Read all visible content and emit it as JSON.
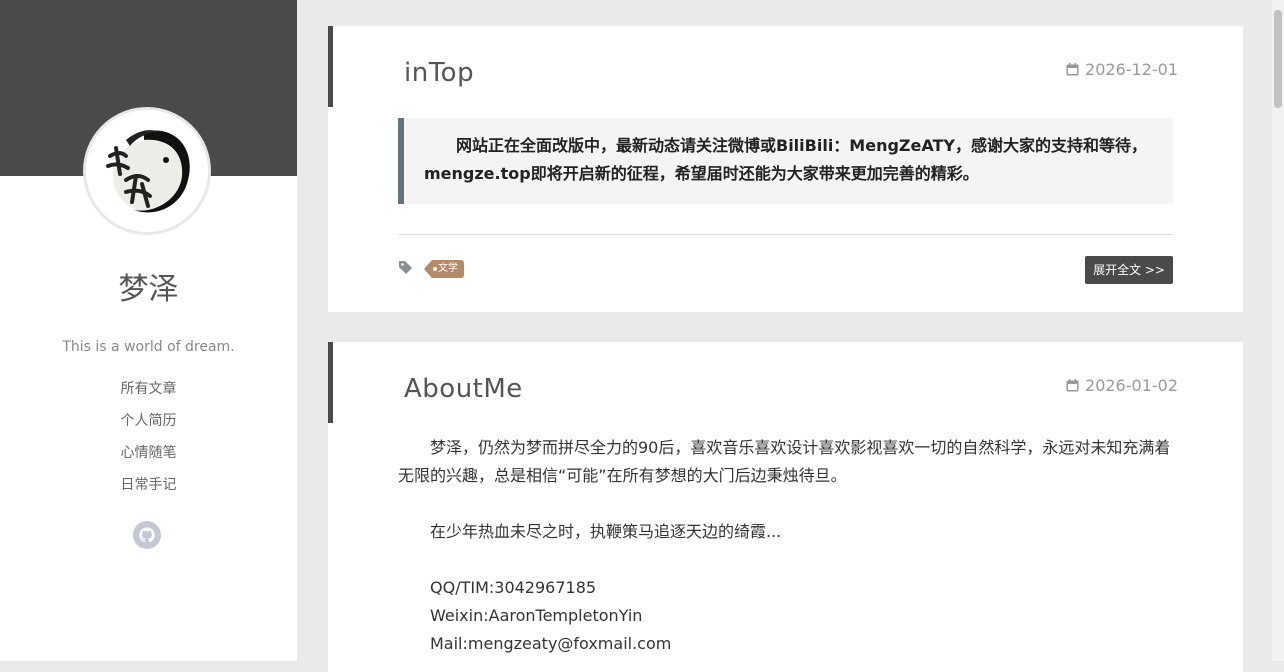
{
  "sidebar": {
    "site_title": "梦泽",
    "description": "This is a world of dream.",
    "nav": [
      "所有文章",
      "个人简历",
      "心情随笔",
      "日常手记"
    ],
    "social_icon": "github-icon"
  },
  "posts": [
    {
      "title": "inTop",
      "date": "2026-12-01",
      "notice": "网站正在全面改版中，最新动态请关注微博或BiliBili：MengZeATY，感谢大家的支持和等待，mengze.top即将开启新的征程，希望届时还能为大家带来更加完善的精彩。",
      "tag": "文学",
      "readmore": "展开全文 >>"
    },
    {
      "title": "AboutMe",
      "date": "2026-01-02",
      "paragraphs": [
        "梦泽，仍然为梦而拼尽全力的90后，喜欢音乐喜欢设计喜欢影视喜欢一切的自然科学，永远对未知充满着无限的兴趣，总是相信“可能”在所有梦想的大门后边秉烛待旦。",
        "在少年热血未尽之时，执鞭策马追逐天边的绮霞..."
      ],
      "contacts": [
        "QQ/TIM:3042967185",
        "Weixin:AaronTempletonYin",
        "Mail:mengzeaty@foxmail.com"
      ]
    }
  ],
  "colors": {
    "banner": "#4a4a4a",
    "accent": "#4a4a4a",
    "tag": "#b58a6a",
    "notice_border": "#65737e"
  }
}
